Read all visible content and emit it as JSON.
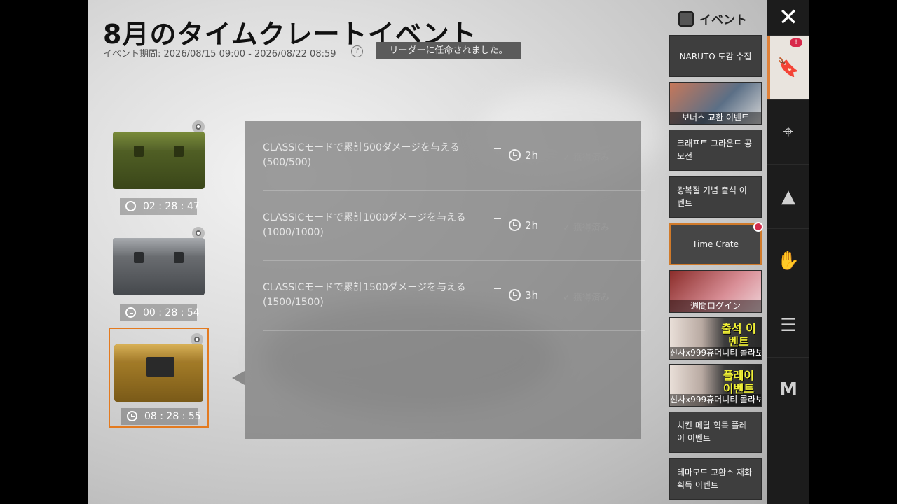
{
  "header": {
    "title": "8月のタイムクレートイベント",
    "period": "イベント期間: 2026/08/15 09:00 - 2026/08/22 08:59",
    "help_icon": "?",
    "toast": "リーダーに任命されました。"
  },
  "crates": [
    {
      "timer": "02 : 28 : 47",
      "color": "green"
    },
    {
      "timer": "00 : 28 : 54",
      "color": "silver"
    },
    {
      "timer": "08 : 28 : 55",
      "color": "gold",
      "selected": true
    }
  ],
  "missions": [
    {
      "desc": "CLASSICモードで累計500ダメージを与える (500/500)",
      "hours": "2h",
      "status": "獲得済み"
    },
    {
      "desc": "CLASSICモードで累計1000ダメージを与える (1000/1000)",
      "hours": "2h",
      "status": "獲得済み"
    },
    {
      "desc": "CLASSICモードで累計1500ダメージを与える (1500/1500)",
      "hours": "3h",
      "status": "獲得済み"
    }
  ],
  "events": {
    "header": "イベント",
    "items": [
      {
        "label": "NARUTO 도감 수집"
      },
      {
        "label": "보너스 교환 이벤트"
      },
      {
        "label": "크래프트 그라운드 공모전"
      },
      {
        "label": "광복절 기념 출석 이벤트"
      },
      {
        "label": "Time Crate"
      },
      {
        "label": "週間ログイン"
      },
      {
        "label": "신사x999휴머니티 콜라보",
        "tag": "출석 이벤트"
      },
      {
        "label": "신사x999휴머니티 콜라보",
        "tag": "플레이 이벤트"
      },
      {
        "label": "치킨 메달 획득 플레이 이벤트"
      },
      {
        "label": "테마모드 교환소 재화 획득 이벤트"
      }
    ]
  },
  "rail": {
    "close": "✕",
    "badge": "!",
    "icons": [
      "event-bookmark-icon",
      "map-pin-icon",
      "flame-icon",
      "handshake-icon",
      "ticket-icon",
      "m-logo-icon"
    ]
  }
}
